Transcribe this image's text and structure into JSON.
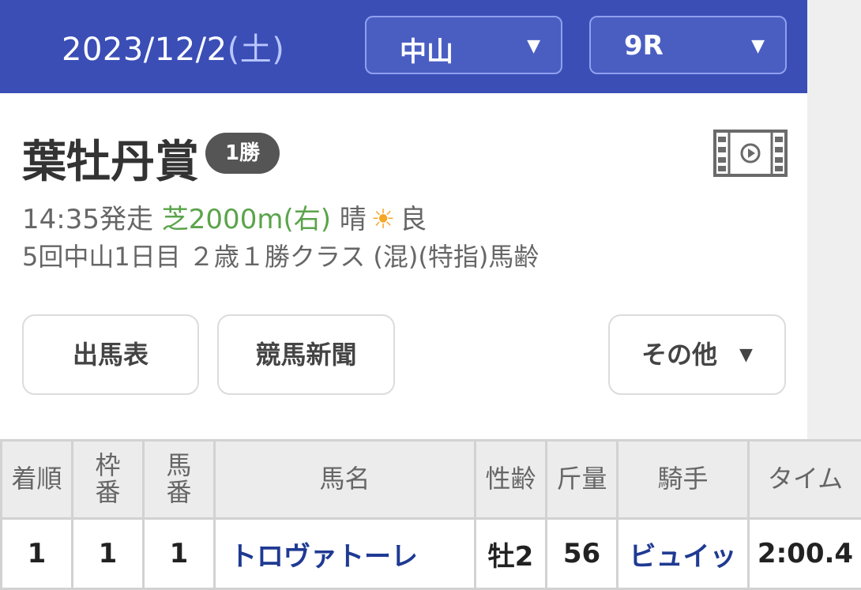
{
  "header": {
    "date": "2023/12/2",
    "day_of_week": "(土)",
    "venue_select": {
      "value": "中山",
      "caret": "▼"
    },
    "race_select": {
      "value": "9R",
      "caret": "▼"
    }
  },
  "race": {
    "name": "葉牡丹賞",
    "grade_badge": "1勝",
    "video_icon": "film-video-icon",
    "start_time": "14:35発走",
    "course": "芝2000m(右)",
    "weather": "晴",
    "weather_icon": "☀",
    "going": "良",
    "detail": "5回中山1日目 ２歳１勝クラス (混)(特指)馬齢"
  },
  "buttons": {
    "entries": "出馬表",
    "newspaper": "競馬新聞",
    "others": "その他",
    "others_caret": "▼"
  },
  "table": {
    "headers": {
      "rank": "着順",
      "frame_top": "枠",
      "frame_bottom": "番",
      "horse_no_top": "馬",
      "horse_no_bottom": "番",
      "horse_name": "馬名",
      "sex_age": "性齢",
      "weight": "斤量",
      "jockey": "騎手",
      "time": "タイム"
    },
    "rows": [
      {
        "rank": "1",
        "frame": "1",
        "horse_no": "1",
        "horse_name": "トロヴァトーレ",
        "sex_age": "牡2",
        "weight": "56",
        "jockey": "ビュイッ",
        "time": "2:00.4"
      }
    ]
  },
  "colors": {
    "header_bg": "#3a4eb6",
    "link": "#1f3a93",
    "course": "#5aa44a",
    "sun": "#f5a623"
  }
}
